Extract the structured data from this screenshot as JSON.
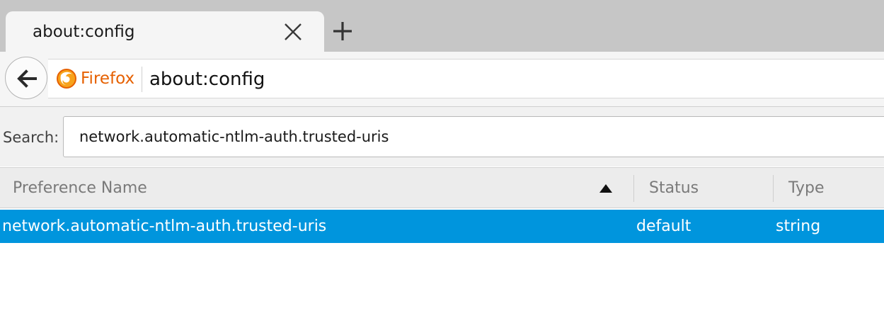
{
  "tab": {
    "title": "about:config",
    "close_icon": "close-icon",
    "new_tab_icon": "plus-icon"
  },
  "navbar": {
    "back_icon": "back-arrow-icon",
    "identity_label": "Firefox",
    "identity_icon": "firefox-logo-icon",
    "url": "about:config"
  },
  "search": {
    "label": "Search:",
    "value": "network.automatic-ntlm-auth.trusted-uris"
  },
  "table": {
    "columns": [
      "Preference Name",
      "Status",
      "Type"
    ],
    "sort_indicator": "sort-ascending-icon",
    "rows": [
      {
        "name": "network.automatic-ntlm-auth.trusted-uris",
        "status": "default",
        "type": "string"
      }
    ]
  },
  "colors": {
    "accent_selected_row": "#0095dd",
    "identity_orange": "#e66000",
    "tabstrip_bg": "#c6c6c6"
  }
}
